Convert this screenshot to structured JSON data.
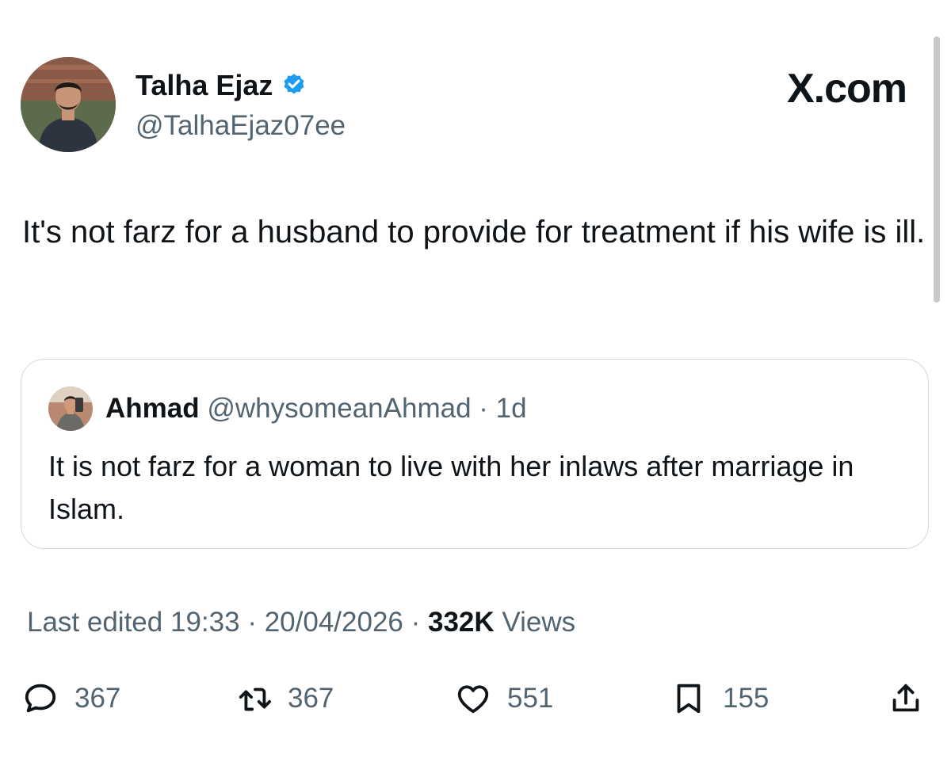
{
  "tweet": {
    "author_name": "Talha Ejaz",
    "author_handle": "@TalhaEjaz07ee",
    "verified_icon": "verified-badge-icon",
    "text": "It's not farz for a husband to provide for treatment if his wife is ill."
  },
  "site_label": "X.com",
  "quoted_tweet": {
    "author_name": "Ahmad",
    "author_handle": "@whysomeanAhmad",
    "separator": "·",
    "time": "1d",
    "text": "It is not farz for a woman to live with her inlaws after marriage in Islam."
  },
  "meta": {
    "edited_label": "Last edited",
    "time": "19:33",
    "separator": "·",
    "date": "20/04/2026",
    "views_count": "332K",
    "views_label": "Views"
  },
  "actions": {
    "replies": "367",
    "retweets": "367",
    "likes": "551",
    "bookmarks": "155"
  },
  "colors": {
    "text_primary": "#0f1419",
    "text_secondary": "#536471",
    "verified_blue": "#1d9bf0",
    "border": "#cfd9de"
  }
}
